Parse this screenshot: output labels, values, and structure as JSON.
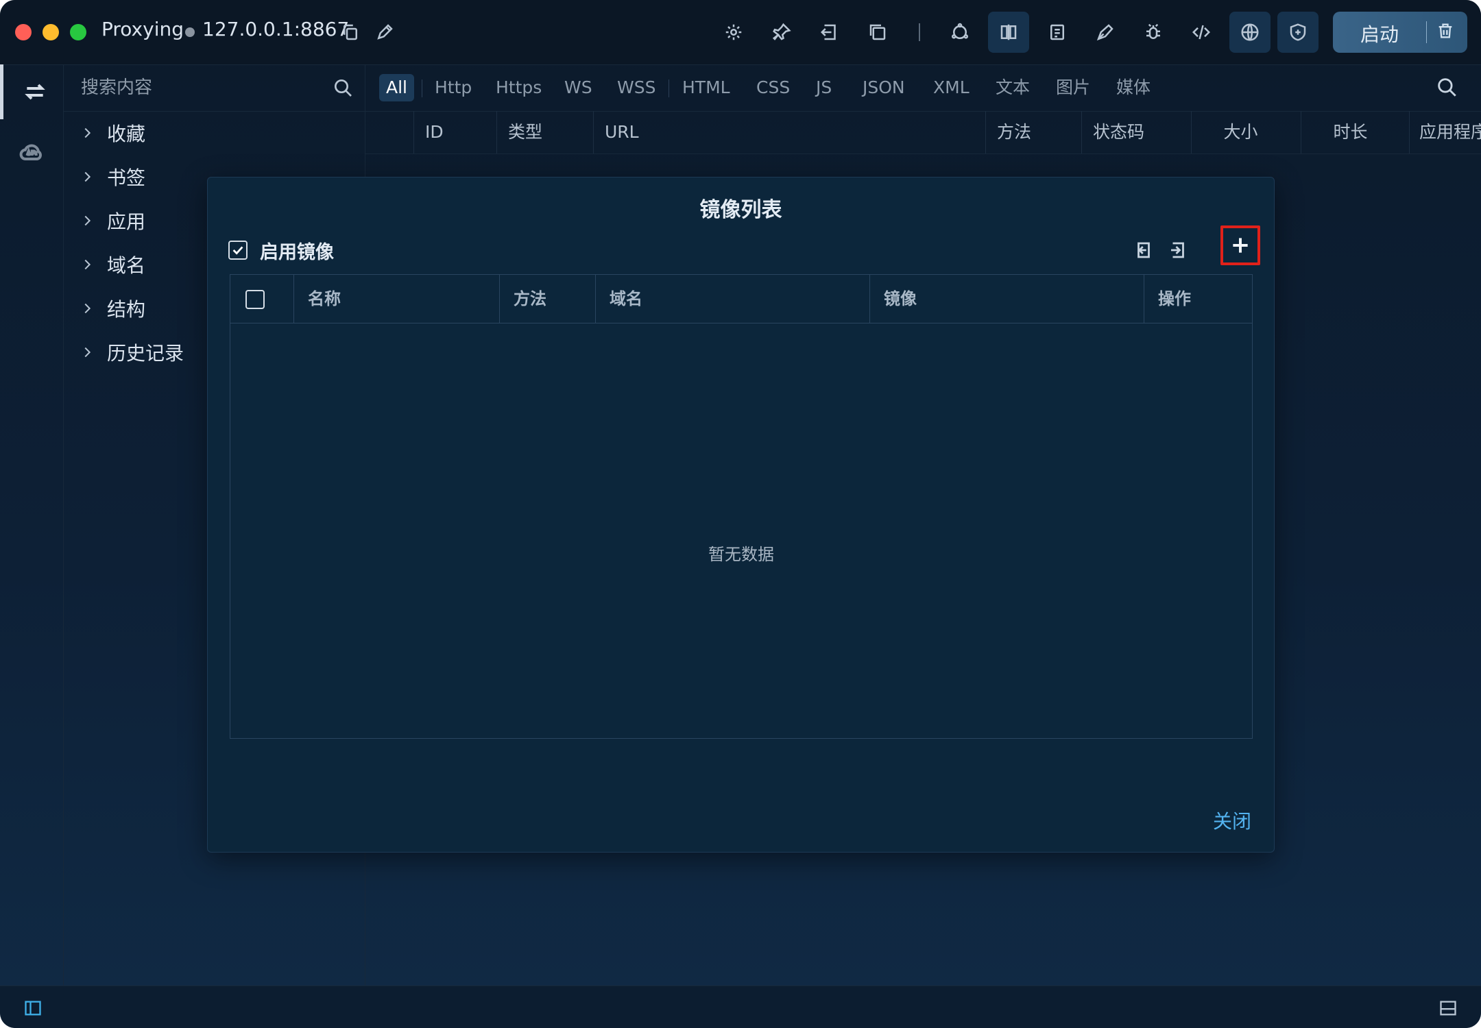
{
  "titlebar": {
    "app_name": "Proxying",
    "address": "127.0.0.1:8867",
    "start_label": "启动"
  },
  "sidebar": {
    "search_placeholder": "搜索内容",
    "items": [
      {
        "label": "收藏"
      },
      {
        "label": "书签"
      },
      {
        "label": "应用"
      },
      {
        "label": "域名"
      },
      {
        "label": "结构"
      },
      {
        "label": "历史记录"
      }
    ]
  },
  "filters": [
    "All",
    "Http",
    "Https",
    "WS",
    "WSS",
    "HTML",
    "CSS",
    "JS",
    "JSON",
    "XML",
    "文本",
    "图片",
    "媒体"
  ],
  "active_filter": "All",
  "columns": [
    "ID",
    "类型",
    "URL",
    "方法",
    "状态码",
    "大小",
    "时长",
    "应用程序"
  ],
  "modal": {
    "title": "镜像列表",
    "enable_label": "启用镜像",
    "enable_checked": true,
    "columns": [
      "名称",
      "方法",
      "域名",
      "镜像",
      "操作"
    ],
    "empty_text": "暂无数据",
    "close_label": "关闭"
  },
  "colors": {
    "accent_link": "#53b3f0",
    "highlight_box": "#e0211a",
    "traffic_red": "#ff5f57",
    "traffic_yellow": "#febc2e",
    "traffic_green": "#28c840"
  }
}
